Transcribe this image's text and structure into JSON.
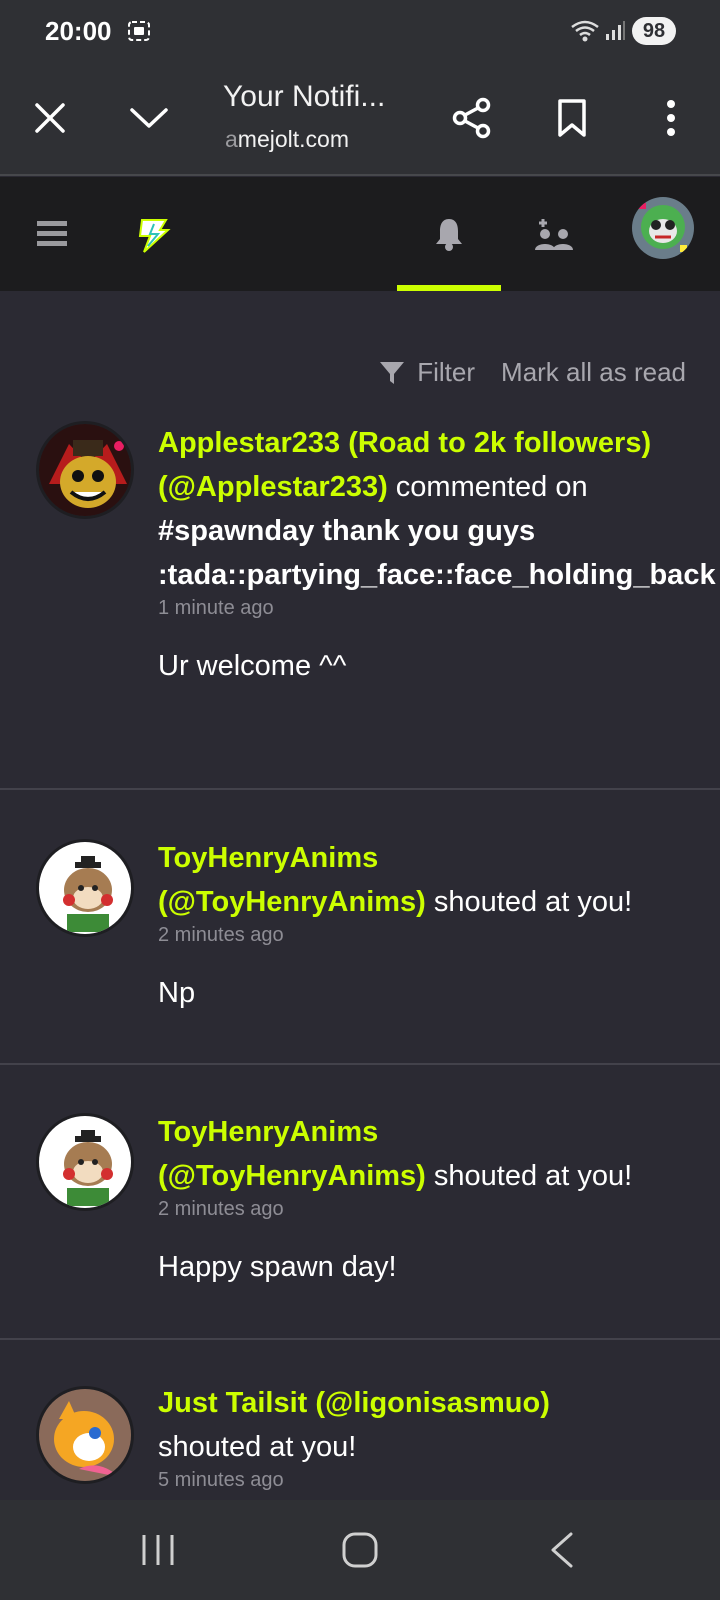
{
  "status_bar": {
    "time": "20:00",
    "battery": "98",
    "icons": [
      "screen-record-icon",
      "wifi-icon",
      "signal-icon",
      "battery-icon"
    ]
  },
  "browser": {
    "page_title": "Your Notifi...",
    "url_prefix": "a",
    "url_rest": "mejolt.com",
    "icons": [
      "close-icon",
      "chevron-down-icon",
      "share-icon",
      "bookmark-icon",
      "more-vert-icon"
    ]
  },
  "site_nav": {
    "icons": [
      "hamburger-menu-icon",
      "gamejolt-logo-icon",
      "bell-icon",
      "friends-icon",
      "user-avatar"
    ],
    "active_color": "#ccff00"
  },
  "toolbar": {
    "filter_label": "Filter",
    "mark_all_label": "Mark all as read"
  },
  "notifications": [
    {
      "user": "Applestar233 (Road to 2k followers) (@Applestar233)",
      "action": "commented on",
      "target": "#spawnday thank you guys :tada::partying_face::face_holding_back",
      "time": "1 minute ago",
      "message": "Ur welcome ^^"
    },
    {
      "user_line1": "ToyHenryAnims",
      "user_line2": "(@ToyHenryAnims)",
      "action": "shouted at you!",
      "time": "2 minutes ago",
      "message": "Np"
    },
    {
      "user_line1": "ToyHenryAnims",
      "user_line2": "(@ToyHenryAnims)",
      "action": "shouted at you!",
      "time": "2 minutes ago",
      "message": "Happy spawn day!"
    },
    {
      "user": "Just Tailsit (@ligonisasmuo)",
      "action": "shouted at you!",
      "time": "5 minutes ago"
    }
  ],
  "bottom_nav": {
    "icons": [
      "recent-apps-icon",
      "home-icon",
      "back-icon"
    ]
  }
}
